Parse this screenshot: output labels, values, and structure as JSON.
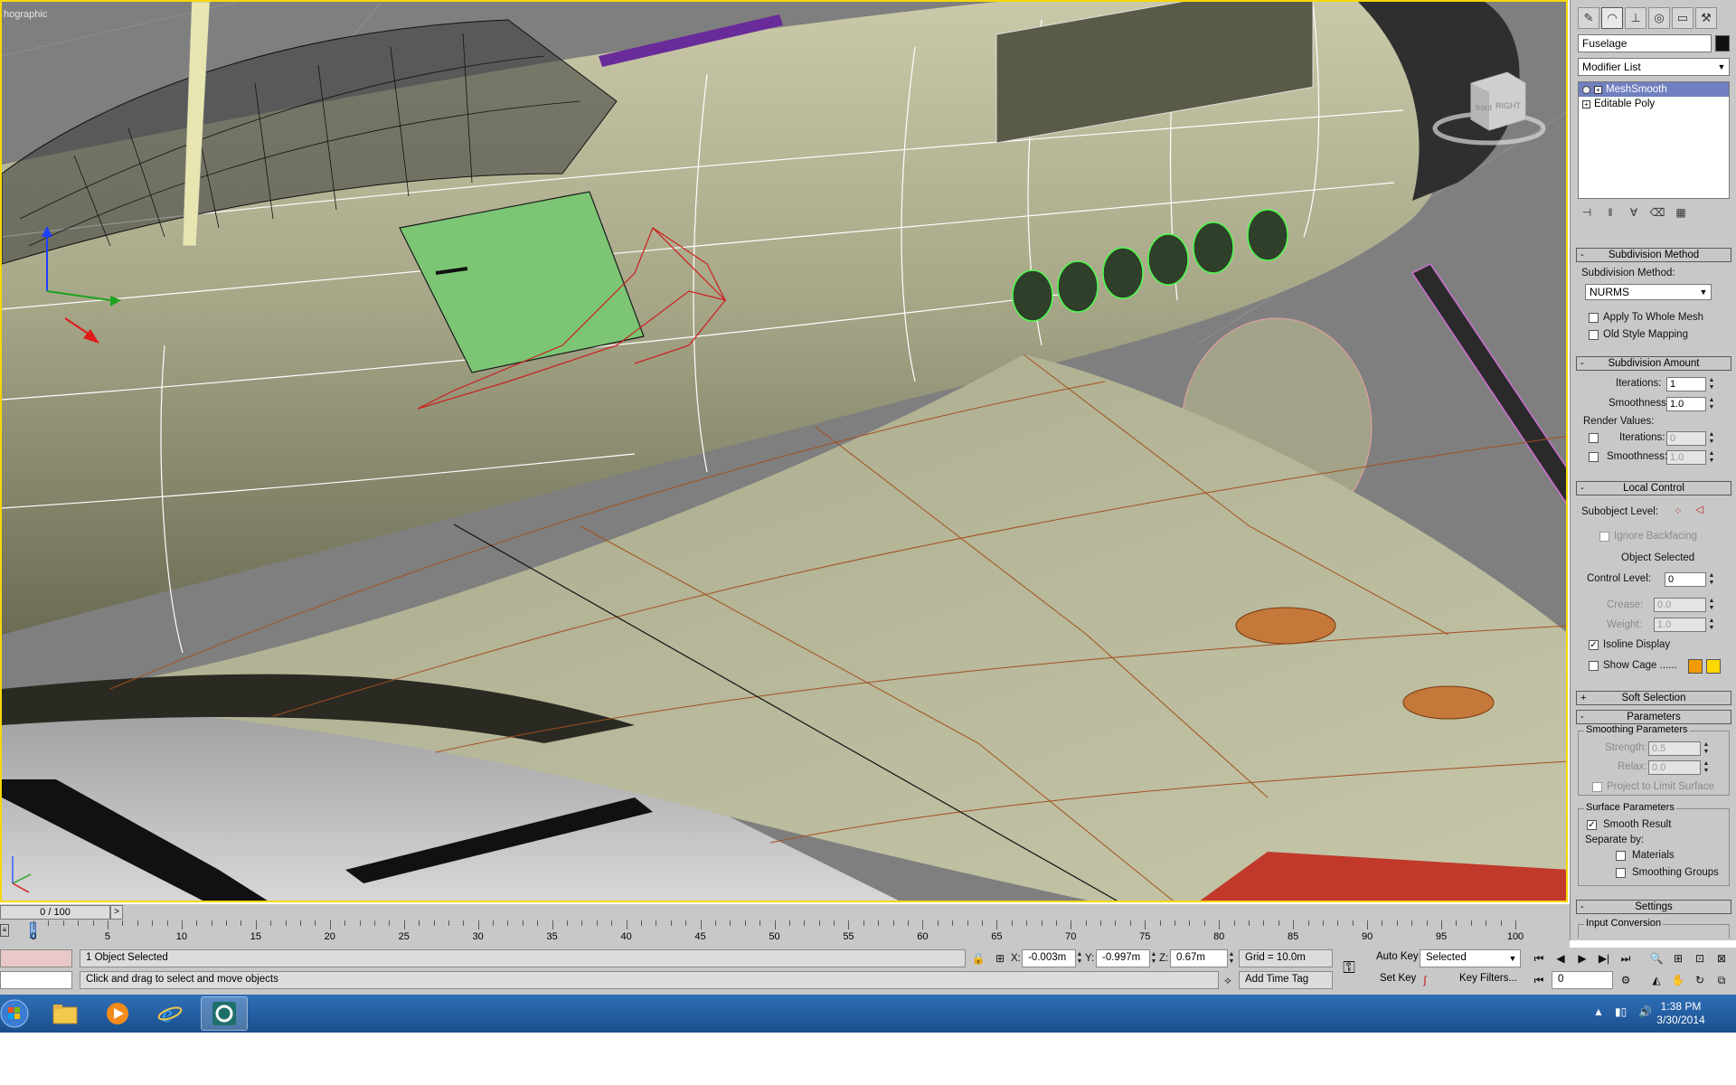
{
  "viewport": {
    "label": "hographic",
    "viewcube_faces": [
      "front",
      "RIGHT"
    ]
  },
  "command_panel": {
    "tab_icons": [
      "create-icon",
      "modify-icon",
      "hierarchy-icon",
      "motion-icon",
      "display-icon",
      "utilities-icon"
    ],
    "object_name": "Fuselage",
    "object_color": "#111111",
    "modifier_list_label": "Modifier List",
    "stack": [
      {
        "label": "MeshSmooth",
        "selected": true
      },
      {
        "label": "Editable Poly",
        "selected": false
      }
    ],
    "rollouts": {
      "subdivision_method": {
        "title": "Subdivision Method",
        "method_label": "Subdivision Method:",
        "method_value": "NURMS",
        "apply_whole_mesh": "Apply To Whole Mesh",
        "old_style_mapping": "Old Style Mapping"
      },
      "subdivision_amount": {
        "title": "Subdivision Amount",
        "iterations_label": "Iterations:",
        "iterations_value": "1",
        "smoothness_label": "Smoothness:",
        "smoothness_value": "1.0",
        "render_values_label": "Render Values:",
        "render_iterations_label": "Iterations:",
        "render_iterations_value": "0",
        "render_smoothness_label": "Smoothness:",
        "render_smoothness_value": "1.0"
      },
      "local_control": {
        "title": "Local Control",
        "subobject_label": "Subobject Level:",
        "ignore_backfacing": "Ignore Backfacing",
        "object_selected": "Object Selected",
        "control_level_label": "Control Level:",
        "control_level_value": "0",
        "crease_label": "Crease:",
        "crease_value": "0.0",
        "weight_label": "Weight:",
        "weight_value": "1.0",
        "isoline_display": "Isoline Display",
        "show_cage": "Show Cage ......",
        "cage_color_1": "#f29a00",
        "cage_color_2": "#ffd800"
      },
      "soft_selection": {
        "title": "Soft Selection"
      },
      "parameters": {
        "title": "Parameters",
        "smoothing_params_title": "Smoothing Parameters",
        "strength_label": "Strength:",
        "strength_value": "0.5",
        "relax_label": "Relax:",
        "relax_value": "0.0",
        "project_limit": "Project to Limit Surface",
        "surface_params_title": "Surface Parameters",
        "smooth_result": "Smooth Result",
        "separate_by": "Separate by:",
        "materials": "Materials",
        "smoothing_groups": "Smoothing Groups"
      },
      "settings": {
        "title": "Settings",
        "input_conversion_title": "Input Conversion"
      }
    }
  },
  "timeline": {
    "frame_display": "0 / 100",
    "next_label": ">",
    "tick_labels": [
      "0",
      "5",
      "10",
      "15",
      "20",
      "25",
      "30",
      "35",
      "40",
      "45",
      "50",
      "55",
      "60",
      "65",
      "70",
      "75",
      "80",
      "85",
      "90",
      "95",
      "100"
    ]
  },
  "status": {
    "selection_count": "1 Object Selected",
    "prompt": "Click and drag to select and move objects",
    "x_label": "X:",
    "x_value": "-0.003m",
    "y_label": "Y:",
    "y_value": "-0.997m",
    "z_label": "Z:",
    "z_value": "0.67m",
    "grid": "Grid = 10.0m",
    "add_time_tag": "Add Time Tag",
    "auto_key": "Auto Key",
    "set_key": "Set Key",
    "selected_dropdown": "Selected",
    "key_filters": "Key Filters...",
    "frame_field": "0"
  },
  "taskbar": {
    "time": "1:38 PM",
    "date": "3/30/2014"
  }
}
